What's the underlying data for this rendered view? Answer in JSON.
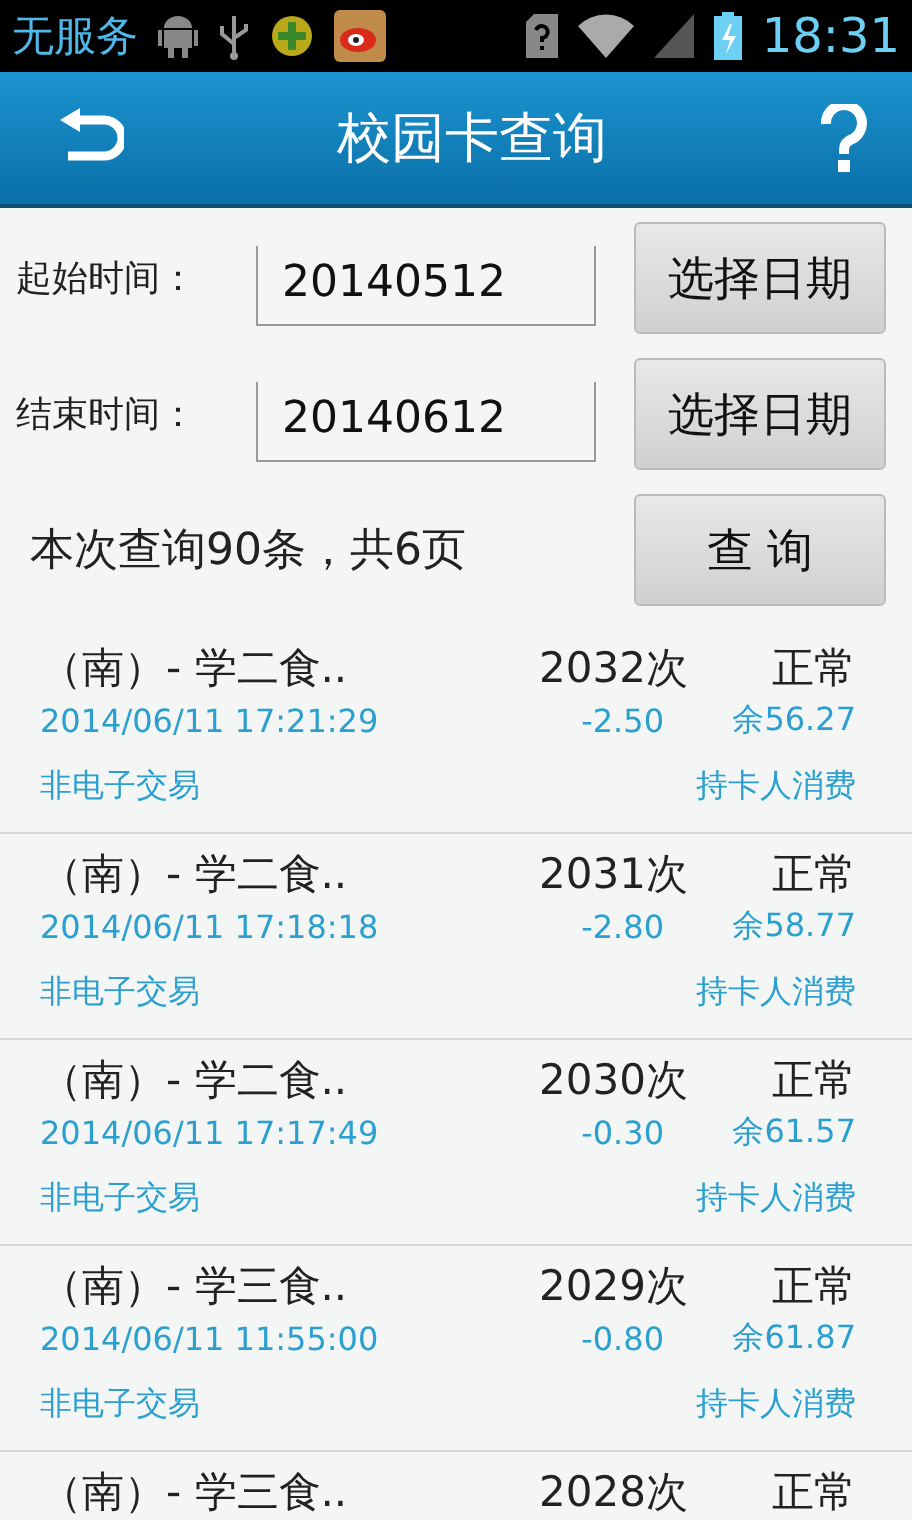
{
  "status_bar": {
    "carrier": "无服务",
    "time": "18:31"
  },
  "header": {
    "title": "校园卡查询"
  },
  "form": {
    "fields": [
      {
        "label": "起始时间：",
        "value": "20140512",
        "button": "选择日期"
      },
      {
        "label": "结束时间：",
        "value": "20140612",
        "button": "选择日期"
      }
    ],
    "summary": "本次查询90条，共6页",
    "query_button": "查 询"
  },
  "records": [
    {
      "place": "（南）- 学二食..",
      "count": "2032次",
      "status": "正常",
      "time": "2014/06/11 17:21:29",
      "amount": "-2.50",
      "balance": "余56.27",
      "type": "非电子交易",
      "category": "持卡人消费"
    },
    {
      "place": "（南）- 学二食..",
      "count": "2031次",
      "status": "正常",
      "time": "2014/06/11 17:18:18",
      "amount": "-2.80",
      "balance": "余58.77",
      "type": "非电子交易",
      "category": "持卡人消费"
    },
    {
      "place": "（南）- 学二食..",
      "count": "2030次",
      "status": "正常",
      "time": "2014/06/11 17:17:49",
      "amount": "-0.30",
      "balance": "余61.57",
      "type": "非电子交易",
      "category": "持卡人消费"
    },
    {
      "place": "（南）- 学三食..",
      "count": "2029次",
      "status": "正常",
      "time": "2014/06/11 11:55:00",
      "amount": "-0.80",
      "balance": "余61.87",
      "type": "非电子交易",
      "category": "持卡人消费"
    },
    {
      "place": "（南）- 学三食..",
      "count": "2028次",
      "status": "正常"
    }
  ]
}
